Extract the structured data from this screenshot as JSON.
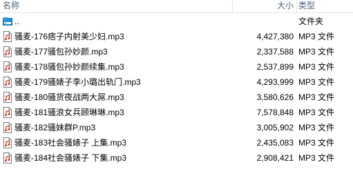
{
  "columns": {
    "name": "名称",
    "size": "大小",
    "type": "类型"
  },
  "rows": [
    {
      "name": "..",
      "size": "",
      "type": "文件夹",
      "icon": "folder-up-icon"
    },
    {
      "name": "骚麦-176痞子内射美少妇.mp3",
      "size": "4,427,380",
      "type": "MP3 文件",
      "icon": "mp3-file-icon"
    },
    {
      "name": "骚麦-177骚包孙妙颜.mp3",
      "size": "2,337,588",
      "type": "MP3 文件",
      "icon": "mp3-file-icon"
    },
    {
      "name": "骚麦-178骚包孙妙颜续集.mp3",
      "size": "2,537,899",
      "type": "MP3 文件",
      "icon": "mp3-file-icon"
    },
    {
      "name": "骚麦-179骚婊子李小璐出轨门.mp3",
      "size": "4,293,999",
      "type": "MP3 文件",
      "icon": "mp3-file-icon"
    },
    {
      "name": "骚麦-180骚货夜战两大屌.mp3",
      "size": "3,580,626",
      "type": "MP3 文件",
      "icon": "mp3-file-icon"
    },
    {
      "name": "骚麦-181骚浪女兵顾琳琳.mp3",
      "size": "7,578,848",
      "type": "MP3 文件",
      "icon": "mp3-file-icon"
    },
    {
      "name": "骚麦-182骚妹群P.mp3",
      "size": "3,005,902",
      "type": "MP3 文件",
      "icon": "mp3-file-icon"
    },
    {
      "name": "骚麦-183社会骚婊子 上集.mp3",
      "size": "2,435,083",
      "type": "MP3 文件",
      "icon": "mp3-file-icon"
    },
    {
      "name": "骚麦-184社会骚婊子 下集.mp3",
      "size": "2,908,421",
      "type": "MP3 文件",
      "icon": "mp3-file-icon"
    }
  ]
}
